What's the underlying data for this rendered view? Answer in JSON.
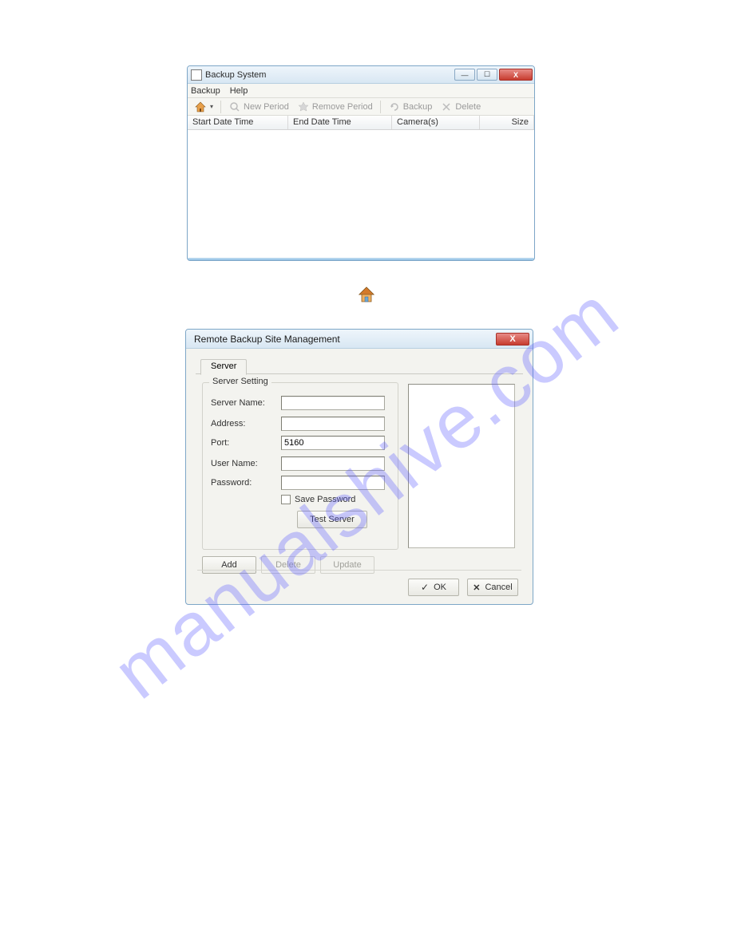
{
  "watermark": "manualshive.com",
  "win1": {
    "title": "Backup System",
    "menus": {
      "backup": "Backup",
      "help": "Help"
    },
    "toolbar": {
      "new_period": "New Period",
      "remove_period": "Remove Period",
      "backup": "Backup",
      "delete": "Delete"
    },
    "columns": {
      "start": "Start Date Time",
      "end": "End Date Time",
      "cameras": "Camera(s)",
      "size": "Size"
    }
  },
  "win2": {
    "title": "Remote Backup Site Management",
    "tab": "Server",
    "group_title": "Server Setting",
    "labels": {
      "server_name": "Server Name:",
      "address": "Address:",
      "port": "Port:",
      "user_name": "User Name:",
      "password": "Password:"
    },
    "values": {
      "server_name": "",
      "address": "",
      "port": "5160",
      "user_name": "",
      "password": ""
    },
    "save_password": "Save Password",
    "buttons": {
      "test_server": "Test Server",
      "add": "Add",
      "delete": "Delete",
      "update": "Update",
      "ok": "OK",
      "cancel": "Cancel"
    }
  }
}
